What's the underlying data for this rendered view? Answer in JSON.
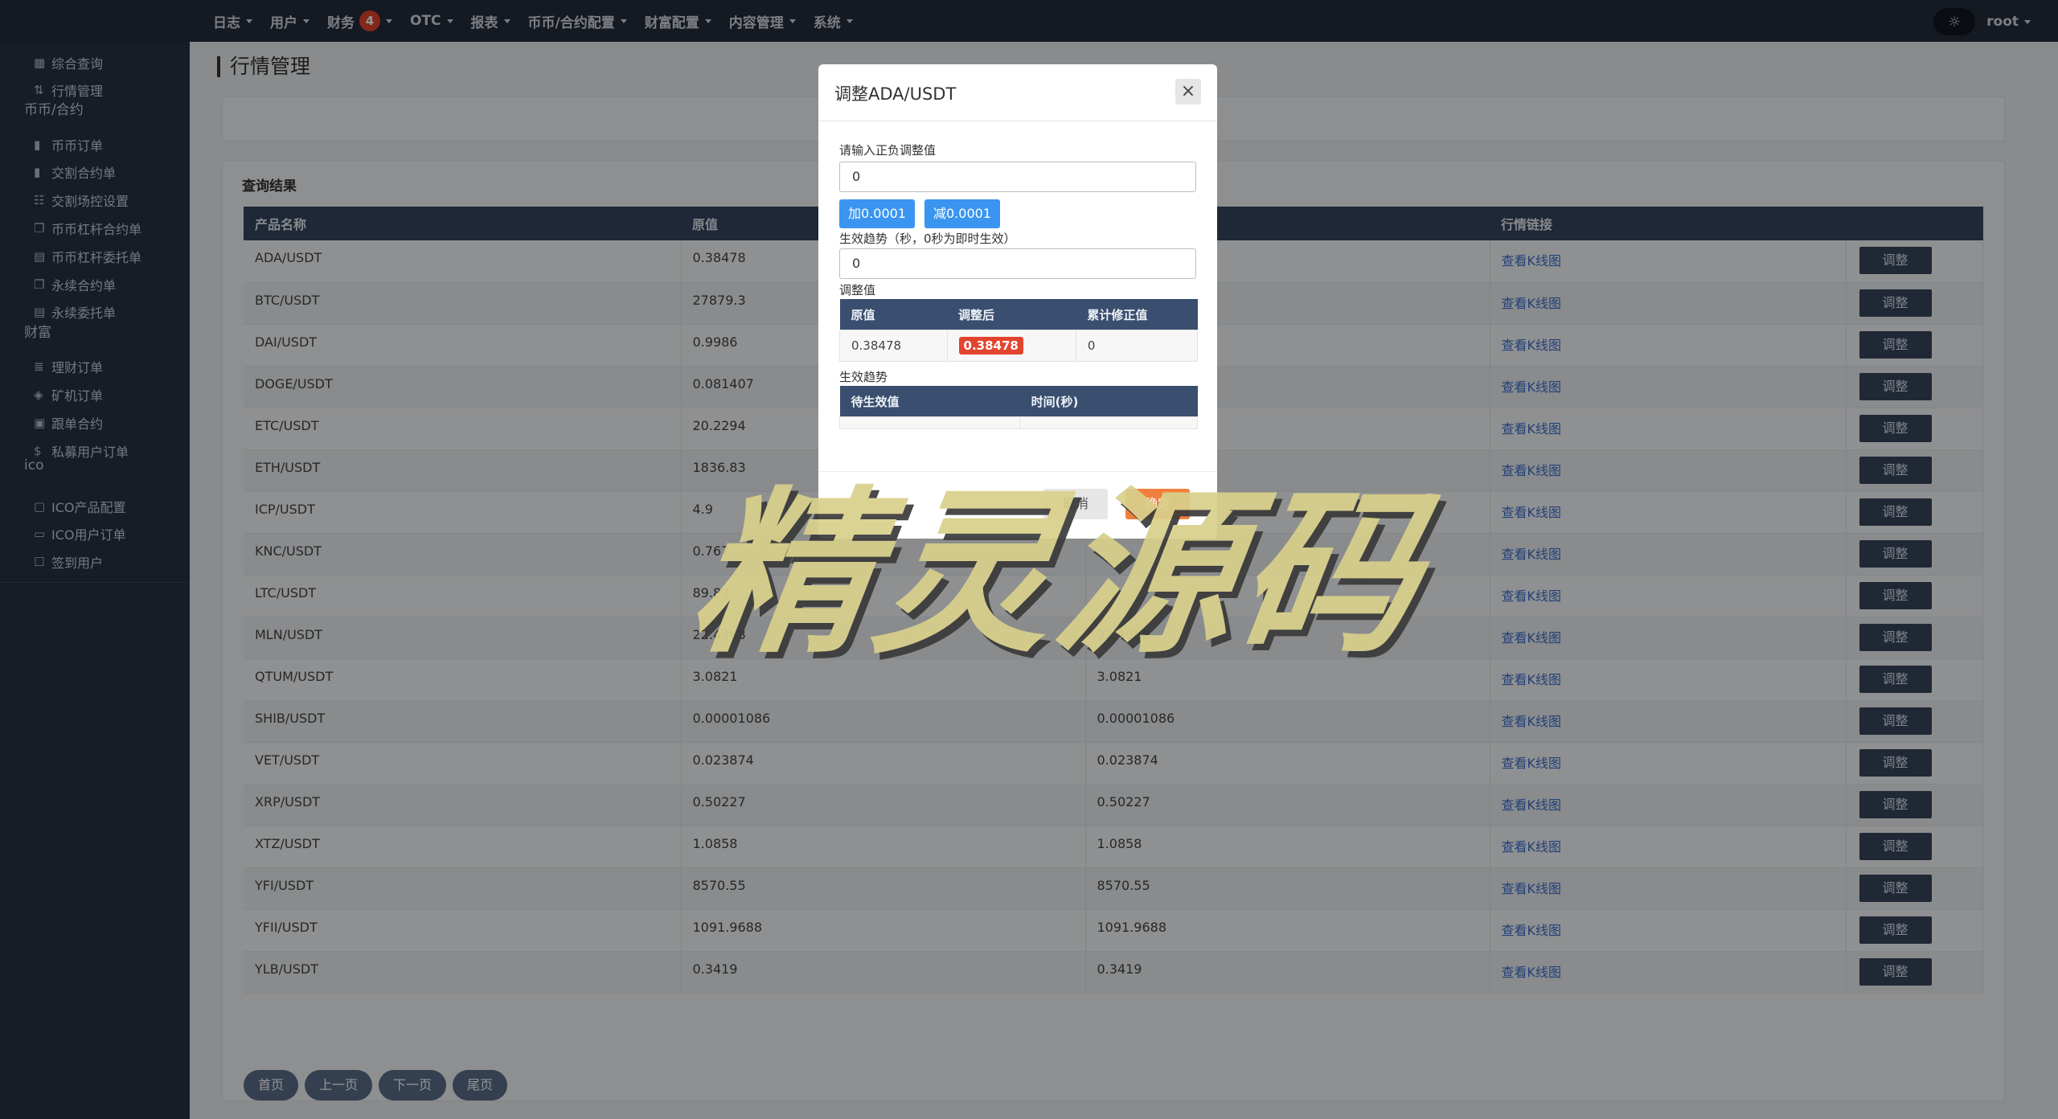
{
  "topnav": [
    {
      "label": "日志",
      "badge": ""
    },
    {
      "label": "用户",
      "badge": ""
    },
    {
      "label": "财务",
      "badge": "4"
    },
    {
      "label": "OTC",
      "badge": ""
    },
    {
      "label": "报表",
      "badge": ""
    },
    {
      "label": "币币/合约配置",
      "badge": ""
    },
    {
      "label": "财富配置",
      "badge": ""
    },
    {
      "label": "内容管理",
      "badge": ""
    },
    {
      "label": "系统",
      "badge": ""
    }
  ],
  "user": {
    "name": "root"
  },
  "sidebar": {
    "items": [
      {
        "label": "综合查询",
        "icon": "grid-icon"
      },
      {
        "label": "行情管理",
        "icon": "sort-icon"
      },
      {
        "label": "币币订单",
        "icon": "bookmark-icon"
      },
      {
        "label": "交割合约单",
        "icon": "bookmark-icon"
      },
      {
        "label": "交割场控设置",
        "icon": "document-icon"
      },
      {
        "label": "币币杠杆合约单",
        "icon": "copy-icon"
      },
      {
        "label": "币币杠杆委托单",
        "icon": "calculator-icon"
      },
      {
        "label": "永续合约单",
        "icon": "copy-icon"
      },
      {
        "label": "永续委托单",
        "icon": "calculator-icon"
      },
      {
        "label": "理财订单",
        "icon": "database-icon"
      },
      {
        "label": "矿机订单",
        "icon": "layers-icon"
      },
      {
        "label": "跟单合约",
        "icon": "calendar-icon"
      },
      {
        "label": "私募用户订单",
        "icon": "dollar-icon"
      },
      {
        "label": "ICO产品配置",
        "icon": "file-icon"
      },
      {
        "label": "ICO用户订单",
        "icon": "message-icon"
      },
      {
        "label": "签到用户",
        "icon": "edit-icon"
      }
    ],
    "groups": [
      "币币/合约",
      "财富",
      "ico"
    ]
  },
  "page": {
    "title": "行情管理",
    "results_title": "查询结果"
  },
  "table": {
    "headers": [
      "产品名称",
      "原值",
      "",
      "行情链接",
      ""
    ],
    "link_label": "查看K线图",
    "adjust_label": "调整",
    "rows": [
      {
        "name": "ADA/USDT",
        "orig": "0.38478",
        "adj": ""
      },
      {
        "name": "BTC/USDT",
        "orig": "27879.3",
        "adj": ""
      },
      {
        "name": "DAI/USDT",
        "orig": "0.9986",
        "adj": ""
      },
      {
        "name": "DOGE/USDT",
        "orig": "0.081407",
        "adj": ""
      },
      {
        "name": "ETC/USDT",
        "orig": "20.2294",
        "adj": ""
      },
      {
        "name": "ETH/USDT",
        "orig": "1836.83",
        "adj": ""
      },
      {
        "name": "ICP/USDT",
        "orig": "4.9",
        "adj": ""
      },
      {
        "name": "KNC/USDT",
        "orig": "0.767",
        "adj": ""
      },
      {
        "name": "LTC/USDT",
        "orig": "89.83",
        "adj": ""
      },
      {
        "name": "MLN/USDT",
        "orig": "22.4968",
        "adj": "22.4968"
      },
      {
        "name": "QTUM/USDT",
        "orig": "3.0821",
        "adj": "3.0821"
      },
      {
        "name": "SHIB/USDT",
        "orig": "0.00001086",
        "adj": "0.00001086"
      },
      {
        "name": "VET/USDT",
        "orig": "0.023874",
        "adj": "0.023874"
      },
      {
        "name": "XRP/USDT",
        "orig": "0.50227",
        "adj": "0.50227"
      },
      {
        "name": "XTZ/USDT",
        "orig": "1.0858",
        "adj": "1.0858"
      },
      {
        "name": "YFI/USDT",
        "orig": "8570.55",
        "adj": "8570.55"
      },
      {
        "name": "YFII/USDT",
        "orig": "1091.9688",
        "adj": "1091.9688"
      },
      {
        "name": "YLB/USDT",
        "orig": "0.3419",
        "adj": "0.3419"
      }
    ]
  },
  "pager": [
    "首页",
    "上一页",
    "下一页",
    "尾页"
  ],
  "modal": {
    "title": "调整ADA/USDT",
    "close": "×",
    "label_value": "请输入正负调整值",
    "value": "0",
    "plus_btn": "加0.0001",
    "minus_btn": "减0.0001",
    "label_trend": "生效趋势（秒，0秒为即时生效）",
    "trend": "0",
    "label_adjust": "调整值",
    "adjust_headers": [
      "原值",
      "调整后",
      "累计修正值"
    ],
    "adjust_row": [
      "0.38478",
      "0.38478",
      "0"
    ],
    "label_effect": "生效趋势",
    "effect_headers": [
      "待生效值",
      "时间(秒)"
    ],
    "cancel": "取消",
    "confirm": "确定"
  },
  "watermark": "精灵源码",
  "colors": {
    "topbar": "#242c3b",
    "sidebar": "#293242",
    "table_header": "#35465e",
    "accent_blue": "#3a95f0",
    "badge_red": "#e3442f"
  }
}
